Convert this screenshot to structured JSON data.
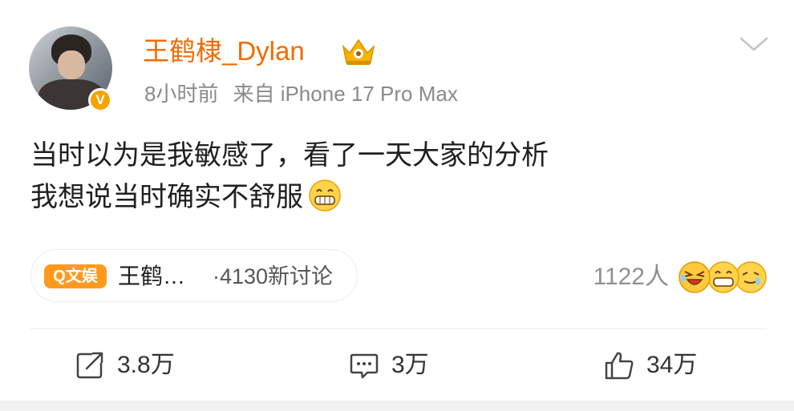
{
  "post": {
    "username": "王鹤棣_Dylan",
    "verified_badge": "V",
    "time": "8小时前",
    "source": "来自 iPhone 17 Pro Max",
    "content_line1": "当时以为是我敏感了，看了一天大家的分析",
    "content_line2": "我想说当时确实不舒服",
    "icons": {
      "crown": "crown-icon",
      "menu": "chevron-down-icon",
      "content_emoji": "grin-emoji-icon",
      "repost": "repost-icon",
      "comment": "comment-icon",
      "like": "like-icon"
    }
  },
  "topic": {
    "tag": "Q文娱",
    "title": "王鹤…",
    "count": "·4130新讨论"
  },
  "reactions": {
    "count_label": "1122人"
  },
  "actions": {
    "repost": "3.8万",
    "comment": "3万",
    "like": "34万"
  },
  "colors": {
    "username": "#f26b00",
    "verified": "#f5a300",
    "topic_tag": "#ff9a1e",
    "meta": "#8a8a8a"
  }
}
